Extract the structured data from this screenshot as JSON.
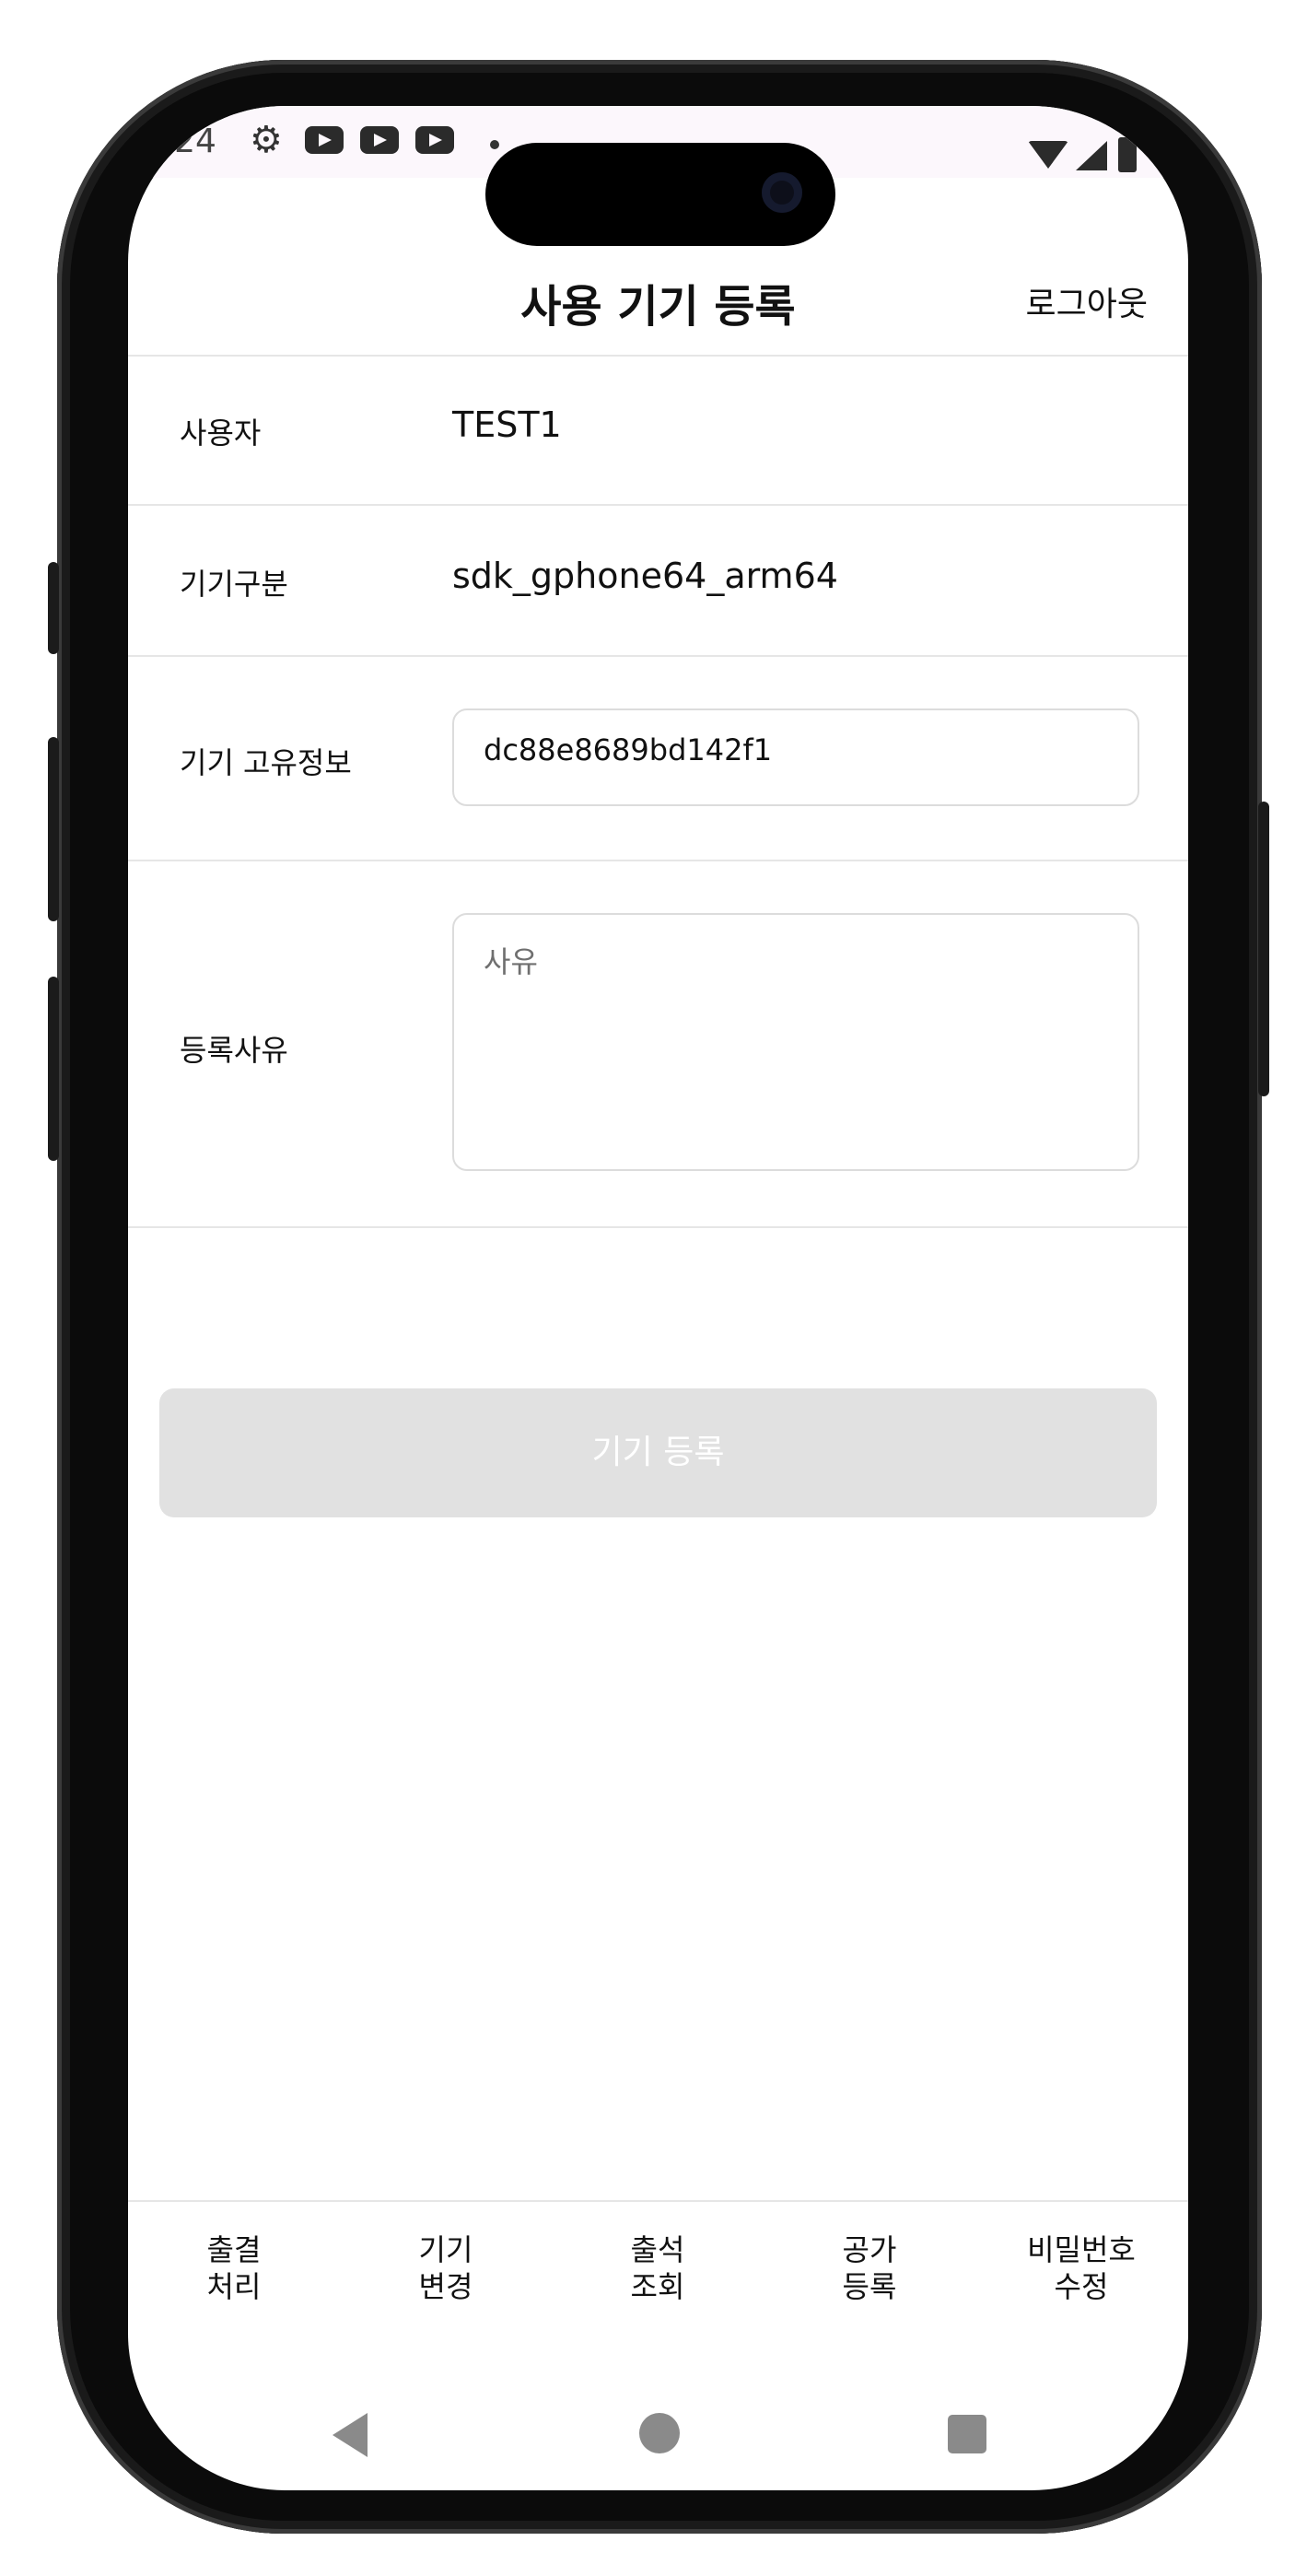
{
  "status_bar": {
    "time": ":24",
    "icons": [
      "gear-icon",
      "youtube-icon",
      "youtube-icon",
      "youtube-icon",
      "dot-icon",
      "wifi-icon",
      "signal-icon",
      "battery-icon"
    ]
  },
  "header": {
    "title": "사용 기기 등록",
    "logout_label": "로그아웃"
  },
  "form": {
    "user": {
      "label": "사용자",
      "value": "TEST1"
    },
    "device_type": {
      "label": "기기구분",
      "value": "sdk_gphone64_arm64"
    },
    "device_id": {
      "label": "기기 고유정보",
      "value": "dc88e8689bd142f1"
    },
    "reason": {
      "label": "등록사유",
      "placeholder": "사유",
      "value": ""
    }
  },
  "register_button": {
    "label": "기기 등록",
    "enabled": false
  },
  "bottom_nav": [
    {
      "line1": "출결",
      "line2": "처리"
    },
    {
      "line1": "기기",
      "line2": "변경"
    },
    {
      "line1": "출석",
      "line2": "조회"
    },
    {
      "line1": "공가",
      "line2": "등록"
    },
    {
      "line1": "비밀번호",
      "line2": "수정"
    }
  ],
  "system_nav": [
    "back-icon",
    "home-icon",
    "recents-icon"
  ],
  "colors": {
    "disabled_button": "#e1e1e1",
    "divider": "#e6e6e6",
    "input_border": "#dcdcdc"
  }
}
